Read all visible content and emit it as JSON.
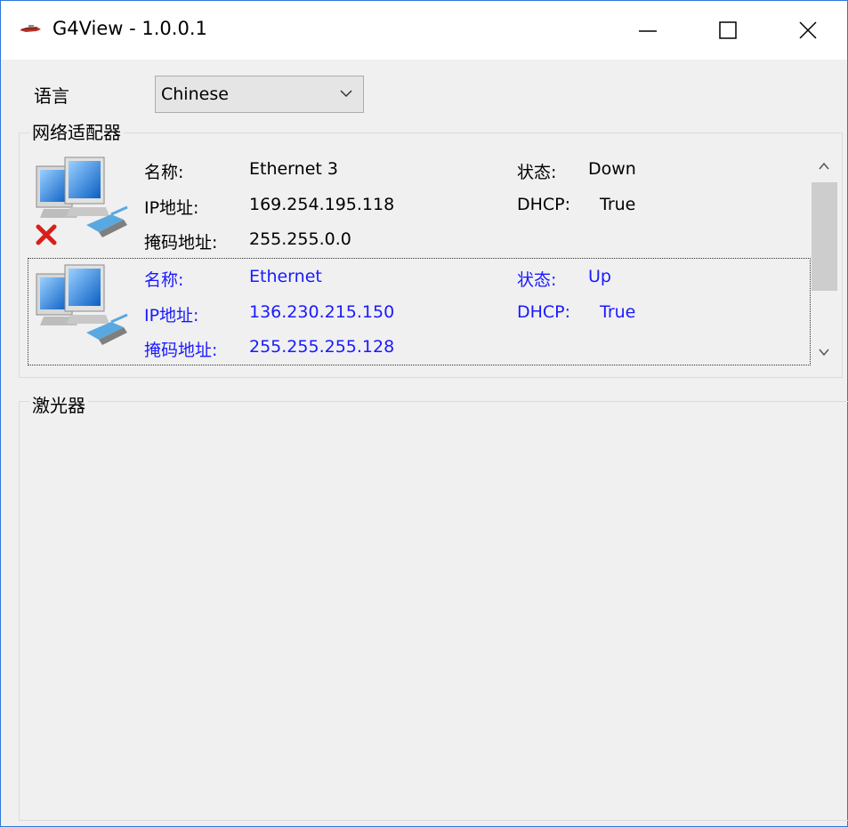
{
  "window": {
    "title": "G4View - 1.0.0.1",
    "accent_color": "#2b79d8",
    "icons": [
      "app-icon",
      "minimize-icon",
      "maximize-icon",
      "close-icon"
    ]
  },
  "language": {
    "label": "语言",
    "selected": "Chinese"
  },
  "adapters_group": {
    "title": "网络适配器",
    "items": [
      {
        "name_label": "名称:",
        "name": "Ethernet 3",
        "ip_label": "IP地址:",
        "ip": "169.254.195.118",
        "mask_label": "掩码地址:",
        "mask": "255.255.0.0",
        "status_label": "状态:",
        "status": "Down",
        "dhcp_label": "DHCP:",
        "dhcp": "True",
        "disconnected": true,
        "selected": false
      },
      {
        "name_label": "名称:",
        "name": "Ethernet",
        "ip_label": "IP地址:",
        "ip": "136.230.215.150",
        "mask_label": "掩码地址:",
        "mask": "255.255.255.128",
        "status_label": "状态:",
        "status": "Up",
        "dhcp_label": "DHCP:",
        "dhcp": "True",
        "disconnected": false,
        "selected": true
      }
    ]
  },
  "laser_group": {
    "title": "激光器"
  },
  "colors": {
    "selected_text": "#1a1aff",
    "error_x": "#d8201b"
  }
}
